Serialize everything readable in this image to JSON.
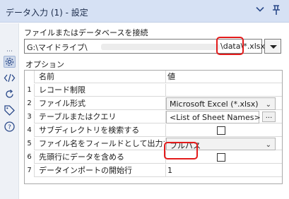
{
  "window": {
    "title": "データ入力 (1) - 設定"
  },
  "connection": {
    "label": "ファイルまたはデータベースを接続",
    "path_prefix": "G:\\マイドライブ\\",
    "path_suffix": "\\data\\*.xlsx"
  },
  "options": {
    "label": "オプション",
    "columns": {
      "name": "名前",
      "value": "値"
    },
    "rows": [
      {
        "num": "1",
        "name": "レコード制限",
        "value": ""
      },
      {
        "num": "2",
        "name": "ファイル形式",
        "value": "Microsoft Excel (*.xlsx)"
      },
      {
        "num": "3",
        "name": "テーブルまたはクエリ",
        "value": "<List of Sheet Names>",
        "button": "..."
      },
      {
        "num": "4",
        "name": "サブディレクトリを検索する",
        "checked": false
      },
      {
        "num": "5",
        "name": "ファイル名をフィールドとして出力す",
        "value": "フルパス"
      },
      {
        "num": "6",
        "name": "先頭行にデータを含める",
        "checked": false
      },
      {
        "num": "7",
        "name": "データインポートの開始行",
        "value": "1"
      }
    ]
  },
  "icons": {
    "collapse": "chevron-down-icon",
    "pin": "pin-icon",
    "sidebar": [
      "gear-icon",
      "code-icon",
      "refresh-icon",
      "tag-icon",
      "help-icon"
    ]
  },
  "colors": {
    "highlight": "#e31b1b",
    "titlebar": "#d6e1f4"
  }
}
